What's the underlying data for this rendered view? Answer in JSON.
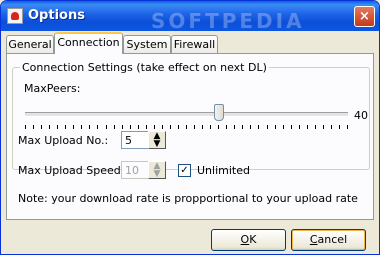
{
  "window": {
    "title": "Options",
    "close_label": "×"
  },
  "watermark": "SOFTPEDIA",
  "tabs": [
    {
      "label": "General"
    },
    {
      "label": "Connection"
    },
    {
      "label": "System"
    },
    {
      "label": "Firewall"
    }
  ],
  "connection": {
    "group_title": "Connection Settings (take effect on next DL)",
    "maxpeers_label": "MaxPeers:",
    "maxpeers_value": "40",
    "maxpeers_slider_fraction": 0.6,
    "max_upload_no_label": "Max Upload No.:",
    "max_upload_no_value": "5",
    "max_upload_speed_label": "Max Upload Speed:",
    "max_upload_speed_value": "10",
    "unlimited_label": "Unlimited",
    "unlimited_checked": true,
    "note": "Note: your download rate is propportional to your upload rate"
  },
  "buttons": {
    "ok_mnemonic": "O",
    "ok_rest": "K",
    "cancel_mnemonic": "C",
    "cancel_rest": "ancel"
  }
}
